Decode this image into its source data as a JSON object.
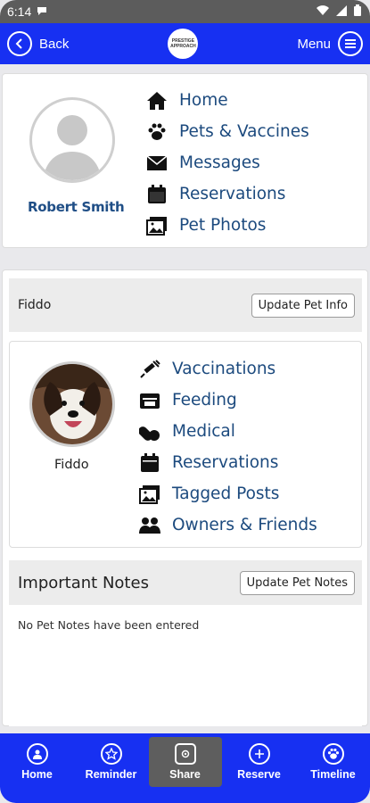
{
  "status_bar": {
    "time": "6:14"
  },
  "header": {
    "back_label": "Back",
    "menu_label": "Menu",
    "logo_text": "PRESTIGE APPROACH"
  },
  "owner": {
    "name": "Robert Smith",
    "nav": [
      {
        "label": "Home",
        "icon": "home-icon"
      },
      {
        "label": "Pets & Vaccines",
        "icon": "paw-icon"
      },
      {
        "label": "Messages",
        "icon": "envelope-icon"
      },
      {
        "label": "Reservations",
        "icon": "calendar-icon"
      },
      {
        "label": "Pet Photos",
        "icon": "photos-icon"
      }
    ]
  },
  "pet_bar": {
    "pet_name": "Fiddo",
    "update_label": "Update Pet Info"
  },
  "pet": {
    "name": "Fiddo",
    "nav": [
      {
        "label": "Vaccinations",
        "icon": "syringe-icon"
      },
      {
        "label": "Feeding",
        "icon": "feeding-icon"
      },
      {
        "label": "Medical",
        "icon": "pills-icon"
      },
      {
        "label": "Reservations",
        "icon": "calendar-icon"
      },
      {
        "label": "Tagged Posts",
        "icon": "photos-icon"
      },
      {
        "label": "Owners & Friends",
        "icon": "users-icon"
      }
    ]
  },
  "notes": {
    "title": "Important Notes",
    "update_label": "Update Pet Notes",
    "empty_text": "No Pet Notes have been entered"
  },
  "bottom_nav": [
    {
      "label": "Home",
      "icon": "home-circle-icon",
      "active": false
    },
    {
      "label": "Reminder",
      "icon": "star-icon",
      "active": false
    },
    {
      "label": "Share",
      "icon": "camera-icon",
      "active": true
    },
    {
      "label": "Reserve",
      "icon": "plus-icon",
      "active": false
    },
    {
      "label": "Timeline",
      "icon": "paw-circle-icon",
      "active": false
    }
  ],
  "colors": {
    "brand_blue": "#1730f2",
    "link_blue": "#1c4a7e",
    "active_tab": "#5e5e5e"
  }
}
